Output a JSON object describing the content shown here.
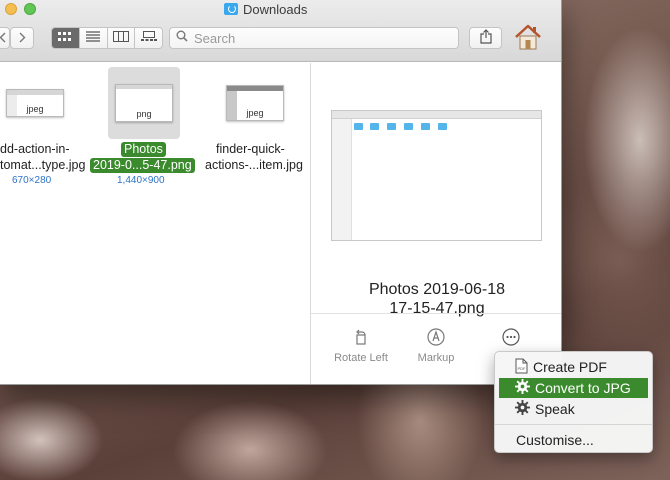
{
  "window": {
    "title": "Downloads",
    "search_placeholder": "Search"
  },
  "toolbar": {
    "views": [
      "icon-view",
      "list-view",
      "column-view",
      "gallery-view"
    ],
    "active_view": "icon-view"
  },
  "files": [
    {
      "thumb_label": "jpeg",
      "name_line1": "dd-action-in-",
      "name_line2": "tomat...type.jpg",
      "dimensions": "670×280",
      "selected": false
    },
    {
      "thumb_label": "png",
      "name_line1": "Photos",
      "name_line2": "2019-0...5-47.png",
      "dimensions": "1,440×900",
      "selected": true
    },
    {
      "thumb_label": "jpeg",
      "name_line1": "finder-quick-",
      "name_line2": "actions-...item.jpg",
      "dimensions": "",
      "selected": false
    }
  ],
  "preview": {
    "name_line1": "Photos 2019-06-18",
    "name_line2": "17-15-47.png",
    "actions": [
      {
        "label": "Rotate Left",
        "icon": "rotate-left-icon"
      },
      {
        "label": "Markup",
        "icon": "markup-icon"
      },
      {
        "label": "",
        "icon": "more-icon"
      }
    ]
  },
  "menu": {
    "items": [
      {
        "label": "Create PDF",
        "icon": "pdf-icon",
        "highlighted": false
      },
      {
        "label": "Convert to JPG",
        "icon": "gear-icon",
        "highlighted": true
      },
      {
        "label": "Speak",
        "icon": "gear-icon",
        "highlighted": false
      }
    ],
    "customise_label": "Customise..."
  },
  "colors": {
    "selection_green": "#3b8a2e",
    "link_blue": "#2d73c7",
    "folder_blue": "#3aa8ec"
  }
}
